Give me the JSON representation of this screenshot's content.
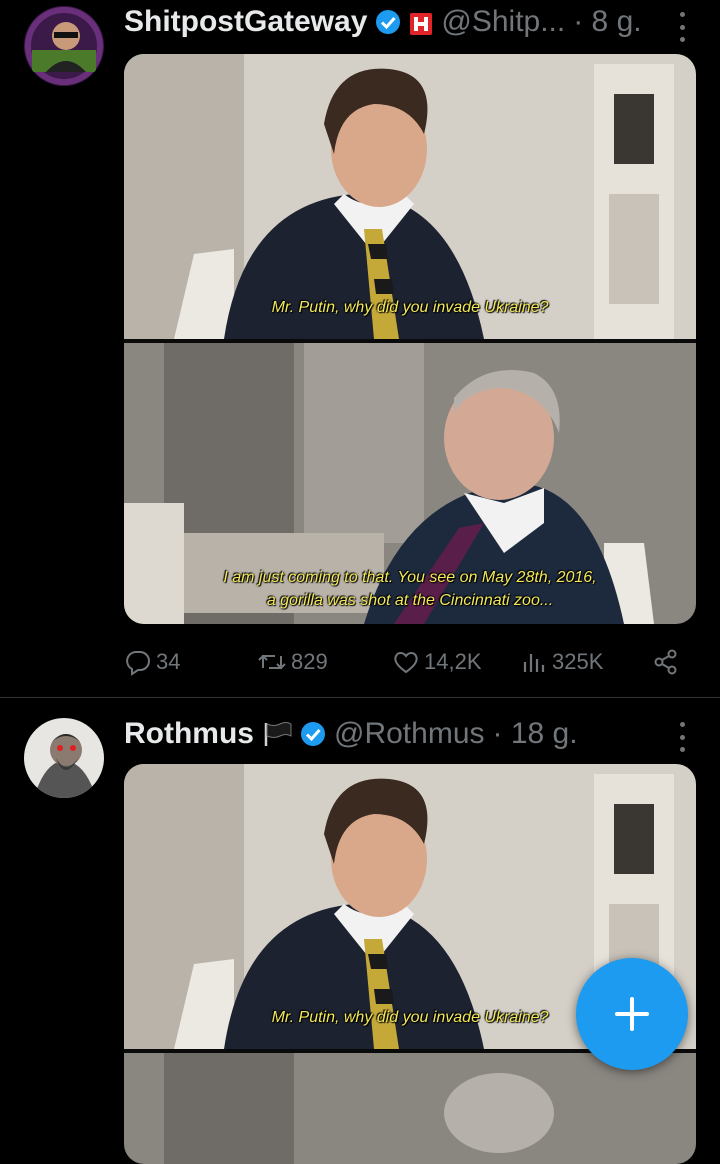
{
  "posts": [
    {
      "name": "ShitpostGateway",
      "handle": "@Shitp...",
      "time": "· 8 g.",
      "subtitle_top": "Mr. Putin, why did you invade Ukraine?",
      "subtitle_bottom_1": "I am just coming to that. You see on May 28th, 2016,",
      "subtitle_bottom_2": "a gorilla was shot at the Cincinnati zoo...",
      "replies": "34",
      "reposts": "829",
      "likes": "14,2K",
      "views": "325K"
    },
    {
      "name": "Rothmus",
      "handle": "@Rothmus",
      "time": "· 18 g.",
      "subtitle_top": "Mr. Putin, why did you invade Ukraine?"
    }
  ],
  "colors": {
    "accent": "#1d9bf0",
    "subtitle": "#f2e85a",
    "muted": "#71767b"
  },
  "icons": [
    "verified-badge-icon",
    "reply-icon",
    "repost-icon",
    "like-icon",
    "views-icon",
    "share-icon",
    "plus-icon"
  ]
}
